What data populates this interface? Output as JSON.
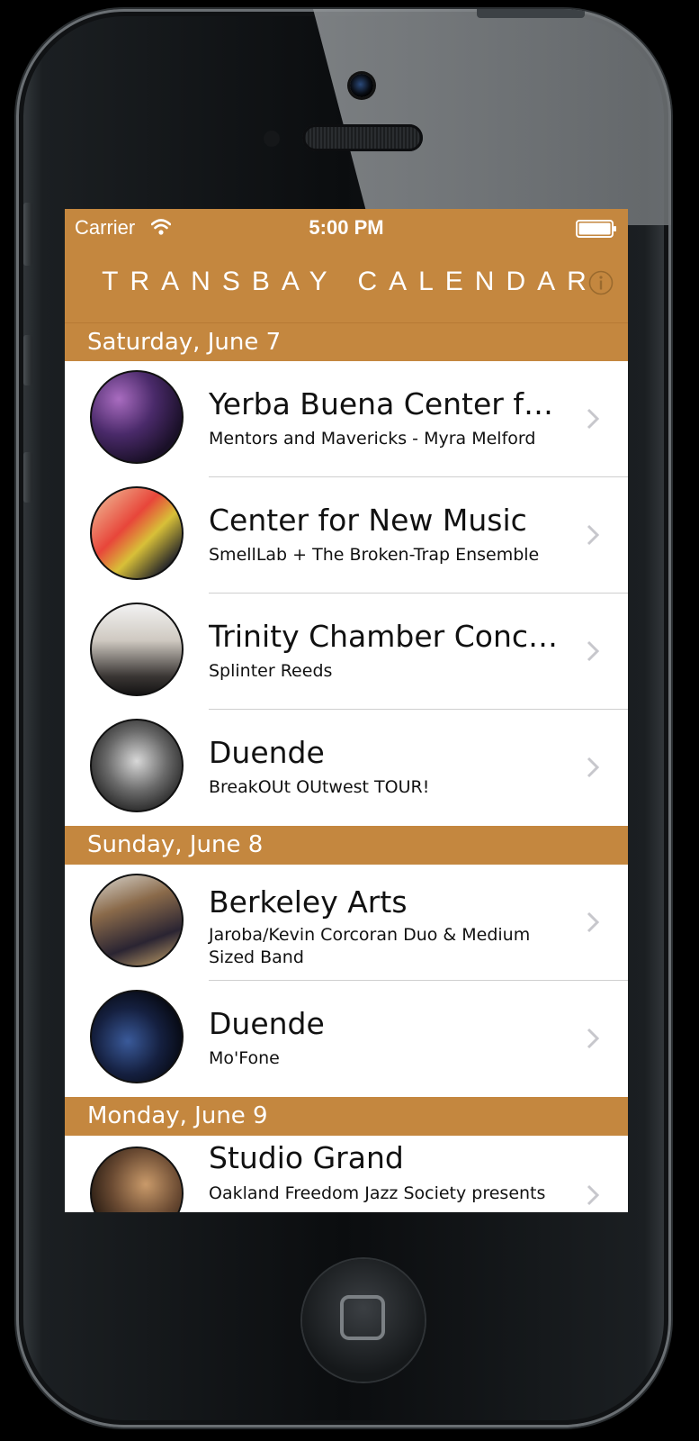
{
  "status_bar": {
    "carrier": "Carrier",
    "time": "5:00 PM"
  },
  "nav": {
    "title": "TRANSBAY CALENDAR"
  },
  "sections": [
    {
      "date": "Saturday, June 7",
      "events": [
        {
          "venue": "Yerba Buena Center for the Arts",
          "venue_display": "Yerba Buena Center for…",
          "lineup": "Mentors and Mavericks - Myra Melford"
        },
        {
          "venue": "Center for New Music",
          "lineup": "SmellLab + The Broken-Trap Ensemble"
        },
        {
          "venue": "Trinity Chamber Concerts",
          "lineup": "Splinter Reeds"
        },
        {
          "venue": "Duende",
          "lineup": "BreakOUt OUtwest TOUR!"
        }
      ]
    },
    {
      "date": "Sunday, June 8",
      "events": [
        {
          "venue": "Berkeley Arts",
          "lineup": "Jaroba/Kevin Corcoran Duo  & Medium Sized Band"
        },
        {
          "venue": "Duende",
          "lineup": "Mo'Fone"
        }
      ]
    },
    {
      "date": "Monday, June 9",
      "events": [
        {
          "venue": "Studio Grand",
          "lineup": "Oakland Freedom Jazz Society presents"
        }
      ]
    }
  ],
  "colors": {
    "accent": "#c4873f",
    "row_background": "#ffffff",
    "text": "#111111",
    "chevron": "#c7c7cc"
  }
}
